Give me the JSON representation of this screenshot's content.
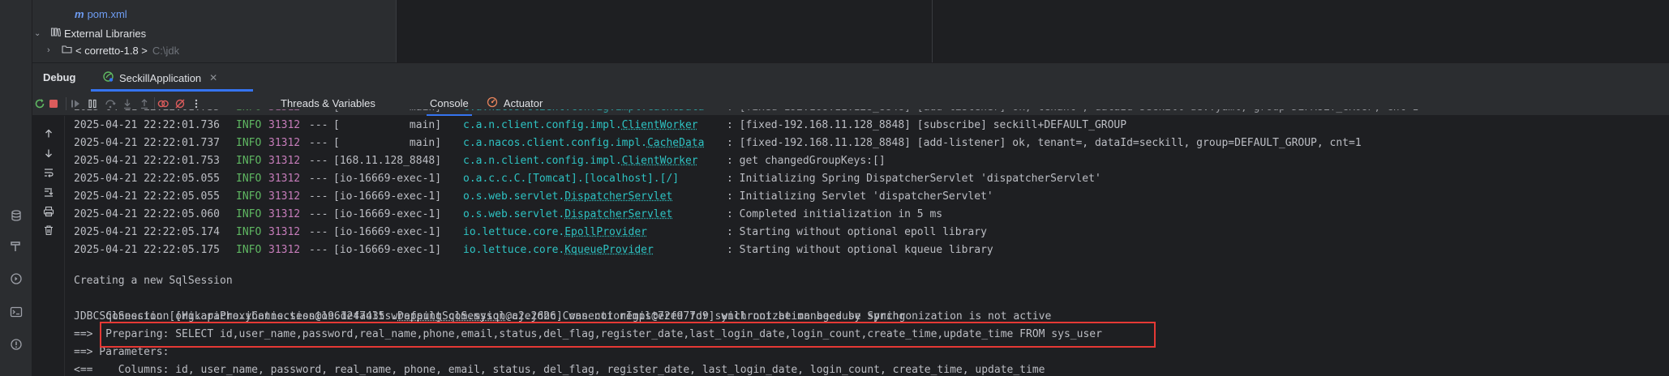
{
  "project_tree": {
    "pom_file": "pom.xml",
    "external_libraries": "External Libraries",
    "jdk_item": "< corretto-1.8 >",
    "jdk_path": "C:\\jdk"
  },
  "debug_panel": {
    "title": "Debug",
    "session_tab": "SeckillApplication"
  },
  "toolbar": {
    "tabs": [
      "Threads & Variables",
      "Console",
      "Actuator"
    ],
    "active_tab": "Console"
  },
  "console": {
    "log_lines": [
      {
        "ts": "2025-04-21 22:22:01.736",
        "lvl": "INFO",
        "pid": "31312",
        "sep": "---",
        "thread": "[           main]",
        "logger_pkg": "c.a.n.client.config.impl.",
        "logger_cls": "ClientWorker",
        "msg": ": [fixed-192.168.11.128_8848] [subscribe] seckill+DEFAULT_GROUP"
      },
      {
        "ts": "2025-04-21 22:22:01.737",
        "lvl": "INFO",
        "pid": "31312",
        "sep": "---",
        "thread": "[           main]",
        "logger_pkg": "c.a.nacos.client.config.impl.",
        "logger_cls": "CacheData",
        "msg": ": [fixed-192.168.11.128_8848] [add-listener] ok, tenant=, dataId=seckill, group=DEFAULT_GROUP, cnt=1"
      },
      {
        "ts": "2025-04-21 22:22:01.753",
        "lvl": "INFO",
        "pid": "31312",
        "sep": "---",
        "thread": "[168.11.128_8848]",
        "logger_pkg": "c.a.n.client.config.impl.",
        "logger_cls": "ClientWorker",
        "msg": ": get changedGroupKeys:[]"
      },
      {
        "ts": "2025-04-21 22:22:05.055",
        "lvl": "INFO",
        "pid": "31312",
        "sep": "---",
        "thread": "[io-16669-exec-1]",
        "logger_pkg": "o.a.c.c.C.[Tomcat].[localhost].[/]",
        "logger_cls": "",
        "msg": ": Initializing Spring DispatcherServlet 'dispatcherServlet'"
      },
      {
        "ts": "2025-04-21 22:22:05.055",
        "lvl": "INFO",
        "pid": "31312",
        "sep": "---",
        "thread": "[io-16669-exec-1]",
        "logger_pkg": "o.s.web.servlet.",
        "logger_cls": "DispatcherServlet",
        "msg": ": Initializing Servlet 'dispatcherServlet'"
      },
      {
        "ts": "2025-04-21 22:22:05.060",
        "lvl": "INFO",
        "pid": "31312",
        "sep": "---",
        "thread": "[io-16669-exec-1]",
        "logger_pkg": "o.s.web.servlet.",
        "logger_cls": "DispatcherServlet",
        "msg": ": Completed initialization in 5 ms"
      },
      {
        "ts": "2025-04-21 22:22:05.174",
        "lvl": "INFO",
        "pid": "31312",
        "sep": "---",
        "thread": "[io-16669-exec-1]",
        "logger_pkg": "io.lettuce.core.",
        "logger_cls": "EpollProvider",
        "msg": ": Starting without optional epoll library"
      },
      {
        "ts": "2025-04-21 22:22:05.175",
        "lvl": "INFO",
        "pid": "31312",
        "sep": "---",
        "thread": "[io-16669-exec-1]",
        "logger_pkg": "io.lettuce.core.",
        "logger_cls": "KqueueProvider",
        "msg": ": Starting without optional kqueue library"
      }
    ],
    "plain_lines": [
      "Creating a new SqlSession",
      "SqlSession [org.apache.ibatis.session.defaults.DefaultSqlSession@a2e2626] was not registered for synchronization because synchronization is not active",
      "JDBC Connection [HikariProxyConnection@1961247435 wrapping com.mysql.cj.jdbc.ConnectionImpl@72f977d9] will not be managed by Spring",
      "==>  Preparing: SELECT id,user_name,password,real_name,phone,email,status,del_flag,register_date,last_login_date,login_count,create_time,update_time FROM sys_user",
      "==> Parameters: ",
      "<==    Columns: id, user_name, password, real_name, phone, email, status, del_flag, register_date, last_login_date, login_count, create_time, update_time"
    ]
  },
  "colors": {
    "accent": "#3574f0",
    "log_level": "#5fb762",
    "pid": "#c77dbb",
    "logger": "#2ec3c3",
    "highlight_box": "#e53935"
  }
}
